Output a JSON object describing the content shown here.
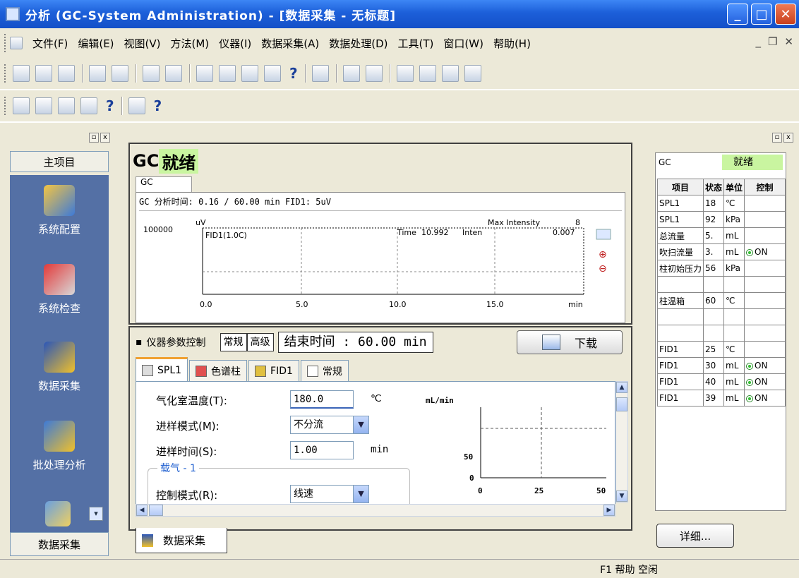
{
  "window": {
    "title": "分析 (GC-System Administration) - [数据采集 - 无标题]"
  },
  "menu": [
    "文件(F)",
    "编辑(E)",
    "视图(V)",
    "方法(M)",
    "仪器(I)",
    "数据采集(A)",
    "数据处理(D)",
    "工具(T)",
    "窗口(W)",
    "帮助(H)"
  ],
  "toolbar": {
    "help_label": "?"
  },
  "sidebar": {
    "title": "主项目",
    "items": [
      {
        "label": "系统配置",
        "icon": "system-config-icon"
      },
      {
        "label": "系统检查",
        "icon": "system-check-icon"
      },
      {
        "label": "数据采集",
        "icon": "data-acquisition-icon"
      },
      {
        "label": "批处理分析",
        "icon": "batch-analysis-icon"
      }
    ],
    "bottom_label": "数据采集"
  },
  "gc_panel": {
    "title_prefix": "GC",
    "title_status": "就绪",
    "tab_label": "GC",
    "status_line": "GC 分析时间: 0.16 / 60.00 min FID1: 5uV",
    "chrom": {
      "y_unit": "uV",
      "y_top_label": "100000",
      "trace_label": "FID1(1.0C)",
      "max_intensity_label": "Max Intensity",
      "max_intensity_value": "8",
      "time_label": "Time",
      "time_value": "10.992",
      "inten_label": "Inten",
      "inten_value": "0.007",
      "x_ticks": [
        "0.0",
        "5.0",
        "10.0",
        "15.0"
      ],
      "x_unit": "min"
    }
  },
  "param_panel": {
    "title": "仪器参数控制",
    "normal_btn": "常规",
    "advanced_btn": "高级",
    "end_time": "结束时间 : 60.00 min",
    "download_label": "下载",
    "tabs": [
      "SPL1",
      "色谱柱",
      "FID1",
      "常规"
    ],
    "fields": [
      {
        "label": "气化室温度(T):",
        "value": "180.0",
        "unit": "℃"
      },
      {
        "label": "进样模式(M):",
        "value": "不分流",
        "unit": ""
      },
      {
        "label": "进样时间(S):",
        "value": "1.00",
        "unit": "min"
      }
    ],
    "carrier_legend": "载气 - 1",
    "cutoff_label": "控制模式(R):",
    "cutoff_value": "线速",
    "mini_chart": {
      "y_unit": "mL/min",
      "y_ticks": [
        "50",
        "0"
      ],
      "x_ticks": [
        "0",
        "25",
        "50"
      ]
    }
  },
  "doc_tab": {
    "label": "数据采集"
  },
  "right_panel": {
    "gc_label": "GC",
    "status": "就绪",
    "headers": [
      "项目",
      "状态",
      "单位",
      "控制"
    ],
    "rows": [
      {
        "item": "SPL1",
        "value": "18",
        "unit": "℃",
        "ctrl": ""
      },
      {
        "item": "SPL1",
        "value": "92",
        "unit": "kPa",
        "ctrl": ""
      },
      {
        "item": "总流量",
        "value": "5.",
        "unit": "mL",
        "ctrl": ""
      },
      {
        "item": "吹扫流量",
        "value": "3.",
        "unit": "mL",
        "ctrl": "ON"
      },
      {
        "item": "柱初始压力",
        "value": "56",
        "unit": "kPa",
        "ctrl": ""
      },
      {
        "item": "",
        "value": "",
        "unit": "",
        "ctrl": ""
      },
      {
        "item": "柱温箱",
        "value": "60",
        "unit": "℃",
        "ctrl": ""
      },
      {
        "item": "",
        "value": "",
        "unit": "",
        "ctrl": ""
      },
      {
        "item": "",
        "value": "",
        "unit": "",
        "ctrl": ""
      },
      {
        "item": "FID1",
        "value": "25",
        "unit": "℃",
        "ctrl": ""
      },
      {
        "item": "FID1",
        "value": "30",
        "unit": "mL",
        "ctrl": "ON"
      },
      {
        "item": "FID1",
        "value": "40",
        "unit": "mL",
        "ctrl": "ON"
      },
      {
        "item": "FID1",
        "value": "39",
        "unit": "mL",
        "ctrl": "ON"
      }
    ],
    "detail_btn": "详细..."
  },
  "statusbar": {
    "text": "F1 帮助 空闲"
  },
  "colors": {
    "title_bar": "#1c5fd9",
    "sidebar_bg": "#5470a5",
    "ready_bg": "#c9f5a0",
    "frame_bg": "#ece9d8"
  }
}
